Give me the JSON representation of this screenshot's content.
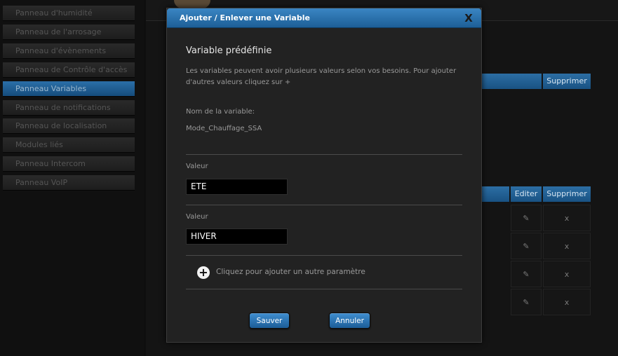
{
  "sidebar": {
    "items": [
      {
        "label": "Panneau d'humidité",
        "active": false
      },
      {
        "label": "Panneau de l'arrosage",
        "active": false
      },
      {
        "label": "Panneau d'évènements",
        "active": false
      },
      {
        "label": "Panneau de Contrôle d'accès",
        "active": false
      },
      {
        "label": "Panneau Variables",
        "active": true
      },
      {
        "label": "Panneau de notifications",
        "active": false
      },
      {
        "label": "Panneau de localisation",
        "active": false
      },
      {
        "label": "Modules liés",
        "active": false
      },
      {
        "label": "Panneau Intercom",
        "active": false
      },
      {
        "label": "Panneau VoIP",
        "active": false
      }
    ]
  },
  "background": {
    "table1": {
      "delete_header": "Supprimer"
    },
    "table2": {
      "edit_header": "Editer",
      "delete_header": "Supprimer",
      "rows": [
        {
          "edit_icon": "pencil-icon",
          "delete_symbol": "x"
        },
        {
          "edit_icon": "pencil-icon",
          "delete_symbol": "x"
        },
        {
          "edit_icon": "pencil-icon",
          "delete_symbol": "x"
        },
        {
          "edit_icon": "pencil-icon",
          "delete_symbol": "x"
        }
      ]
    }
  },
  "modal": {
    "title": "Ajouter / Enlever une Variable",
    "close_symbol": "X",
    "heading": "Variable prédéfinie",
    "description": "Les variables peuvent avoir plusieurs valeurs selon vos besoins. Pour ajouter d'autres valeurs cliquez sur +",
    "name_label": "Nom de la variable:",
    "name_value": "Mode_Chauffage_SSA",
    "values": [
      {
        "label": "Valeur",
        "value": "ETE"
      },
      {
        "label": "Valeur",
        "value": "HIVER"
      }
    ],
    "add_symbol": "+",
    "add_label": "Cliquez pour ajouter un autre paramètre",
    "save_label": "Sauver",
    "cancel_label": "Annuler"
  },
  "colors": {
    "accent_blue": "#2b6fa8",
    "header_blue": "#3a85c3",
    "modal_bg": "#222222",
    "page_bg": "#0e0e0e"
  }
}
